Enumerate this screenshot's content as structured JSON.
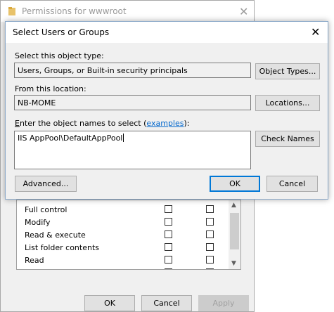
{
  "background_window": {
    "title": "Permissions for wwwroot",
    "close_glyph": "✕",
    "permissions": [
      {
        "label": "Full control",
        "allow": false,
        "deny": false
      },
      {
        "label": "Modify",
        "allow": false,
        "deny": false
      },
      {
        "label": "Read & execute",
        "allow": false,
        "deny": false
      },
      {
        "label": "List folder contents",
        "allow": false,
        "deny": false
      },
      {
        "label": "Read",
        "allow": false,
        "deny": false
      }
    ],
    "buttons": {
      "ok": "OK",
      "cancel": "Cancel",
      "apply": "Apply"
    }
  },
  "dialog": {
    "title": "Select Users or Groups",
    "close_glyph": "✕",
    "object_type_label": "Select this object type:",
    "object_type_value": "Users, Groups, or Built-in security principals",
    "object_types_button": "Object Types...",
    "location_label": "From this location:",
    "location_value": "NB-MOME",
    "locations_button": "Locations...",
    "names_label_prefix": "nter the object names to select (",
    "names_label_accesskey": "E",
    "names_label_link": "examples",
    "names_label_suffix": "):",
    "names_value": "IIS AppPool\\DefaultAppPool",
    "check_names_button": "Check Names",
    "advanced_button": "Advanced...",
    "ok_button": "OK",
    "cancel_button": "Cancel"
  },
  "colors": {
    "accent": "#0078d7",
    "link": "#0066cc",
    "window_bg": "#f0f0f0"
  }
}
